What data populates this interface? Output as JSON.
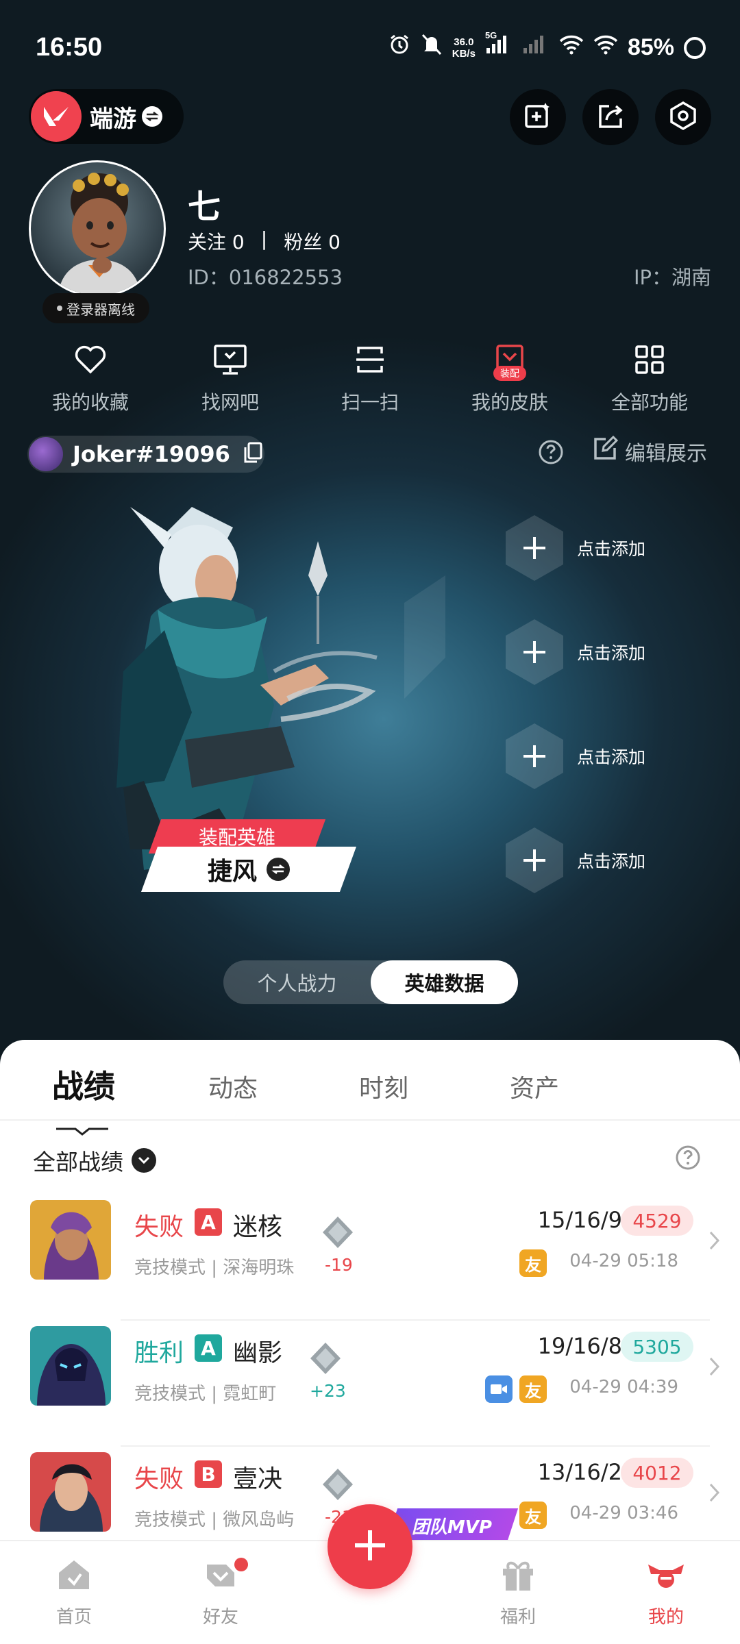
{
  "status_bar": {
    "time": "16:50",
    "net_speed_value": "36.0",
    "net_speed_unit": "KB/s",
    "network": "5G",
    "battery": "85%"
  },
  "header": {
    "game_label": "端游",
    "game_logo_icon": "valorant-logo-icon",
    "actions": [
      "edit-card-icon",
      "share-icon",
      "settings-icon"
    ]
  },
  "profile": {
    "nickname": "七",
    "follow_label": "关注",
    "follow_count": "0",
    "separator": "|",
    "fans_label": "粉丝",
    "fans_count": "0",
    "uid": "ID：016822553",
    "ip": "IP：湖南",
    "status": "登录器离线"
  },
  "quick_functions": [
    {
      "label": "我的收藏",
      "icon": "heart-icon"
    },
    {
      "label": "找网吧",
      "icon": "monitor-icon"
    },
    {
      "label": "扫一扫",
      "icon": "scan-icon"
    },
    {
      "label": "我的皮肤",
      "icon": "skin-icon",
      "badge": "装配"
    },
    {
      "label": "全部功能",
      "icon": "grid-icon"
    }
  ],
  "account": {
    "riot_id": "Joker#19096",
    "edit_label": "编辑展示"
  },
  "hero": {
    "tag": "装配英雄",
    "name": "捷风",
    "add_slots": [
      "点击添加",
      "点击添加",
      "点击添加",
      "点击添加"
    ]
  },
  "toggle": {
    "options": [
      "个人战力",
      "英雄数据"
    ],
    "active_index": 1
  },
  "tabs": {
    "items": [
      "战绩",
      "动态",
      "时刻",
      "资产"
    ],
    "active_index": 0
  },
  "records": {
    "filter_label": "全部战绩",
    "matches": [
      {
        "result": "失败",
        "outcome": "lose",
        "grade": "A",
        "agent": "迷核",
        "mode": "竞技模式 | 深海明珠",
        "rr_change": "-19",
        "kda": "15/16/9",
        "score": "4529",
        "time": "04-29 05:18",
        "friend": "友",
        "video": false,
        "mvp": ""
      },
      {
        "result": "胜利",
        "outcome": "win",
        "grade": "A",
        "agent": "幽影",
        "mode": "竞技模式 | 霓虹町",
        "rr_change": "+23",
        "kda": "19/16/8",
        "score": "5305",
        "time": "04-29 04:39",
        "friend": "友",
        "video": true,
        "mvp": ""
      },
      {
        "result": "失败",
        "outcome": "lose",
        "grade": "B",
        "agent": "壹决",
        "mode": "竞技模式 | 微风岛屿",
        "rr_change": "-21",
        "kda": "13/16/2",
        "score": "4012",
        "time": "04-29 03:46",
        "friend": "友",
        "video": false,
        "mvp": "团队MVP"
      }
    ]
  },
  "bottom_nav": {
    "items": [
      {
        "label": "首页",
        "icon": "home-icon"
      },
      {
        "label": "好友",
        "icon": "friends-icon",
        "dot": true
      },
      {
        "label": "福利",
        "icon": "gift-icon"
      },
      {
        "label": "我的",
        "icon": "me-icon",
        "active": true
      }
    ],
    "fab_icon": "plus-icon"
  },
  "colors": {
    "accent": "#ee3d4a",
    "win": "#1fa89d",
    "lose": "#e8464a"
  }
}
